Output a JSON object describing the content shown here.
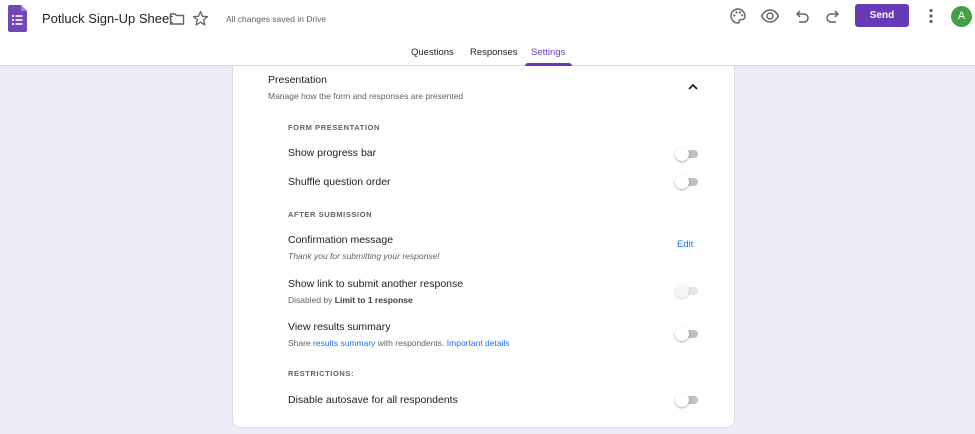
{
  "app": {
    "title": "Potluck Sign-Up Sheet",
    "save_status": "All changes saved in Drive",
    "brand_color": "#673ab7"
  },
  "toolbar": {
    "icons": [
      "palette-icon",
      "preview-eye-icon",
      "undo-icon",
      "redo-icon",
      "more-vert-icon"
    ],
    "send_label": "Send",
    "avatar_letter": "A"
  },
  "tabs": [
    {
      "label": "Questions",
      "active": false
    },
    {
      "label": "Responses",
      "active": false
    },
    {
      "label": "Settings",
      "active": true
    }
  ],
  "presentation": {
    "title": "Presentation",
    "subtitle": "Manage how the form and responses are presented",
    "form_presentation_label": "FORM PRESENTATION",
    "show_progress_bar": {
      "label": "Show progress bar",
      "on": false
    },
    "shuffle_question_order": {
      "label": "Shuffle question order",
      "on": false
    },
    "after_submission_label": "AFTER SUBMISSION",
    "confirmation_message": {
      "label": "Confirmation message",
      "value": "Thank you for submitting your response!",
      "action": "Edit"
    },
    "submit_another": {
      "label": "Show link to submit another response",
      "sub_prefix": "Disabled by",
      "sub_bold": "Limit to 1 response",
      "on": false,
      "disabled": true
    },
    "view_results": {
      "label": "View results summary",
      "sub_prefix": "Share",
      "sub_link": "results summary",
      "sub_mid": "with respondents.",
      "sub_link2": "Important details",
      "on": false
    },
    "restrictions_label": "RESTRICTIONS:",
    "disable_autosave": {
      "label": "Disable autosave for all respondents",
      "on": false
    }
  }
}
